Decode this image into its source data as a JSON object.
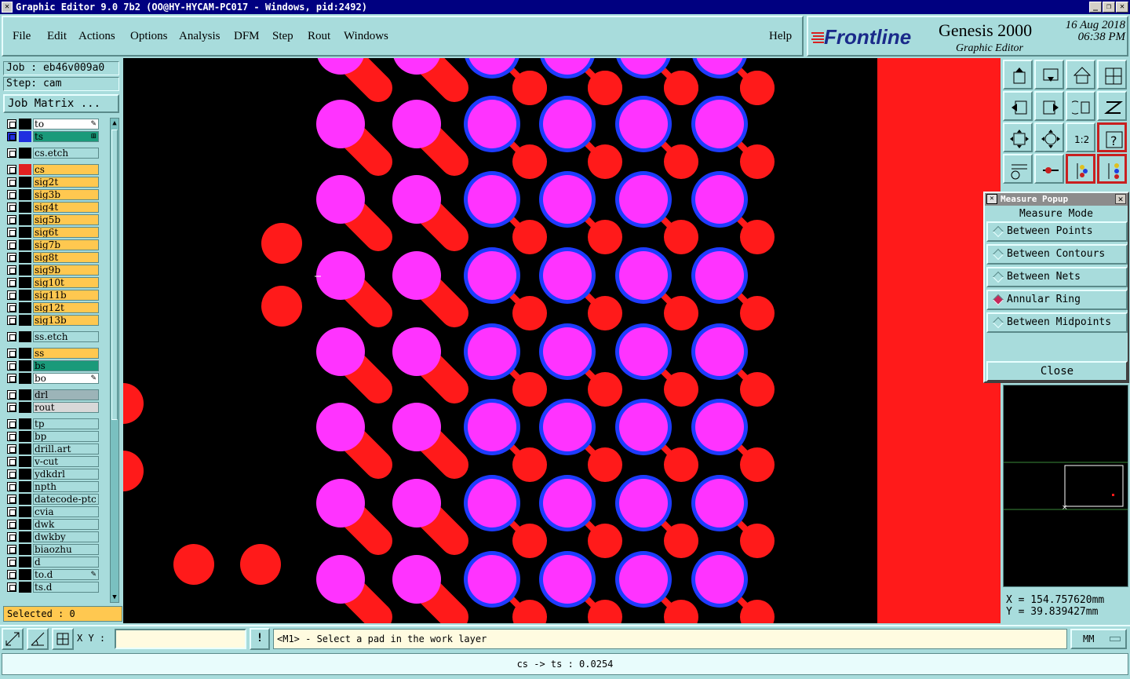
{
  "window": {
    "title": "Graphic Editor 9.0 7b2  (OO@HY-HYCAM-PC017 - Windows, pid:2492)",
    "app_icon": "editor-icon",
    "controls": [
      "_",
      "❐",
      "✕"
    ]
  },
  "menu": [
    {
      "label": "File"
    },
    {
      "label": "Edit"
    },
    {
      "label": "Actions"
    },
    {
      "label": "Options"
    },
    {
      "label": "Analysis"
    },
    {
      "label": "DFM"
    },
    {
      "label": "Step"
    },
    {
      "label": "Rout"
    },
    {
      "label": "Windows"
    },
    {
      "label": "Help"
    }
  ],
  "brand": {
    "logo": "Frontline",
    "product": "Genesis 2000",
    "subtitle": "Graphic Editor",
    "date": "16 Aug 2018",
    "time": "06:38 PM"
  },
  "job": {
    "job_label": "Job : eb46v009a0",
    "step_label": "Step: cam",
    "matrix_button": "Job Matrix ..."
  },
  "layers": [
    {
      "name": "to",
      "color": "#ffffff",
      "swatch": "#000000",
      "mark": "✎"
    },
    {
      "name": "ts",
      "color": "#1a9a7a",
      "swatch": "#2030e0",
      "mark": "⊞",
      "selected": true
    },
    {
      "name": "cs.etch",
      "color": "#a8dcdc",
      "swatch": "#000000",
      "gap": true
    },
    {
      "name": "cs",
      "color": "#ffc850",
      "swatch": "#e02020",
      "gap": true
    },
    {
      "name": "sig2t",
      "color": "#ffc850",
      "swatch": "#000000"
    },
    {
      "name": "sig3b",
      "color": "#ffc850",
      "swatch": "#000000"
    },
    {
      "name": "sig4t",
      "color": "#ffc850",
      "swatch": "#000000"
    },
    {
      "name": "sig5b",
      "color": "#ffc850",
      "swatch": "#000000"
    },
    {
      "name": "sig6t",
      "color": "#ffc850",
      "swatch": "#000000"
    },
    {
      "name": "sig7b",
      "color": "#ffc850",
      "swatch": "#000000"
    },
    {
      "name": "sig8t",
      "color": "#ffc850",
      "swatch": "#000000"
    },
    {
      "name": "sig9b",
      "color": "#ffc850",
      "swatch": "#000000"
    },
    {
      "name": "sig10t",
      "color": "#ffc850",
      "swatch": "#000000"
    },
    {
      "name": "sig11b",
      "color": "#ffc850",
      "swatch": "#000000"
    },
    {
      "name": "sig12t",
      "color": "#ffc850",
      "swatch": "#000000"
    },
    {
      "name": "sig13b",
      "color": "#ffc850",
      "swatch": "#000000"
    },
    {
      "name": "ss.etch",
      "color": "#a8dcdc",
      "swatch": "#000000",
      "gap": true
    },
    {
      "name": "ss",
      "color": "#ffc850",
      "swatch": "#000000",
      "gap": true
    },
    {
      "name": "bs",
      "color": "#1a9a7a",
      "swatch": "#000000"
    },
    {
      "name": "bo",
      "color": "#ffffff",
      "swatch": "#000000",
      "mark": "✎"
    },
    {
      "name": "drl",
      "color": "#9cb4b8",
      "swatch": "#000000",
      "gap": true
    },
    {
      "name": "rout",
      "color": "#d8d8d8",
      "swatch": "#000000"
    },
    {
      "name": "tp",
      "color": "#a8dcdc",
      "swatch": "#000000",
      "gap": true
    },
    {
      "name": "bp",
      "color": "#a8dcdc",
      "swatch": "#000000"
    },
    {
      "name": "drill.art",
      "color": "#a8dcdc",
      "swatch": "#000000"
    },
    {
      "name": "v-cut",
      "color": "#a8dcdc",
      "swatch": "#000000"
    },
    {
      "name": "ydkdrl",
      "color": "#a8dcdc",
      "swatch": "#000000"
    },
    {
      "name": "npth",
      "color": "#a8dcdc",
      "swatch": "#000000"
    },
    {
      "name": "datecode-ptc",
      "color": "#a8dcdc",
      "swatch": "#000000"
    },
    {
      "name": "cvia",
      "color": "#a8dcdc",
      "swatch": "#000000"
    },
    {
      "name": "dwk",
      "color": "#a8dcdc",
      "swatch": "#000000"
    },
    {
      "name": "dwkby",
      "color": "#a8dcdc",
      "swatch": "#000000"
    },
    {
      "name": "biaozhu",
      "color": "#a8dcdc",
      "swatch": "#000000"
    },
    {
      "name": "d",
      "color": "#a8dcdc",
      "swatch": "#000000"
    },
    {
      "name": "to.d",
      "color": "#a8dcdc",
      "swatch": "#000000",
      "mark": "✎"
    },
    {
      "name": "ts.d",
      "color": "#a8dcdc",
      "swatch": "#000000"
    }
  ],
  "selected_text": "Selected : 0",
  "toolbox": [
    "zoom-home-icon",
    "zoom-down-icon",
    "home-icon",
    "layout-icon",
    "pan-left-icon",
    "pan-right-icon",
    "undo-icon",
    "redraw-icon",
    "fit-icon",
    "center-icon",
    "ratio-icon",
    "help-icon",
    "tools-icon",
    "snap-icon",
    "layers-icon",
    "layers-alt-icon"
  ],
  "toolbox_ratio_label": "1:2",
  "measure_popup": {
    "title": "Measure Popup",
    "heading": "Measure Mode",
    "options": [
      {
        "label": "Between Points",
        "checked": false
      },
      {
        "label": "Between Contours",
        "checked": false
      },
      {
        "label": "Between Nets",
        "checked": false
      },
      {
        "label": "Annular Ring",
        "checked": true
      },
      {
        "label": "Between Midpoints",
        "checked": false
      }
    ],
    "close_label": "Close"
  },
  "coords": {
    "x": "X =  154.757620mm",
    "y": "Y =  39.839427mm"
  },
  "command": {
    "xy_label": "X Y :",
    "xy_value": "",
    "prompt": "<M1> - Select a pad in the work layer",
    "unit": "MM"
  },
  "status": "cs -> ts : 0.0254",
  "colors": {
    "panel_bg": "#a8dcdc",
    "pad_magenta": "#ff33ff",
    "ring_blue": "#1e3cff",
    "trace_red": "#ff1a1a",
    "canvas_bg": "#000000"
  }
}
